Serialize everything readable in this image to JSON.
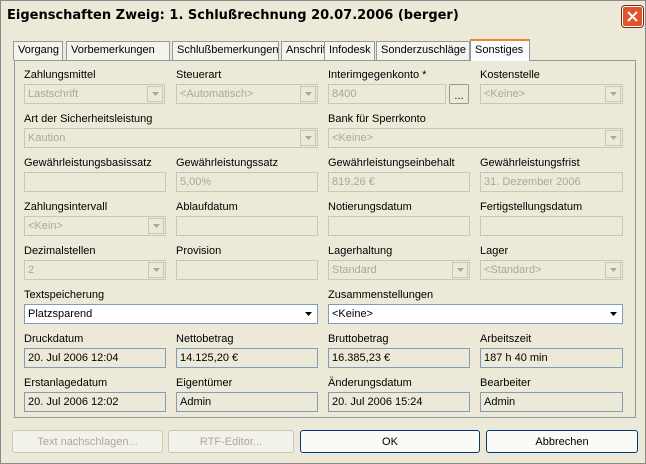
{
  "window": {
    "title": "Eigenschaften Zweig: 1. Schlußrechnung 20.07.2006 (berger)"
  },
  "tabs": [
    {
      "label": "Vorgang"
    },
    {
      "label": "Vorbemerkungen"
    },
    {
      "label": "Schlußbemerkungen"
    },
    {
      "label": "Anschrift"
    },
    {
      "label": "Infodesk"
    },
    {
      "label": "Sonderzuschläge"
    },
    {
      "label": "Sonstiges"
    }
  ],
  "fields": {
    "zahlungsmittel": {
      "label": "Zahlungsmittel",
      "value": "Lastschrift"
    },
    "steuerart": {
      "label": "Steuerart",
      "value": "<Automatisch>"
    },
    "interimgegenkonto": {
      "label": "Interimgegenkonto *",
      "value": "8400",
      "button": "..."
    },
    "kostenstelle": {
      "label": "Kostenstelle",
      "value": "<Keine>"
    },
    "sicherheitsleistung": {
      "label": "Art der Sicherheitsleistung",
      "value": "Kaution"
    },
    "sperrkonto": {
      "label": "Bank für Sperrkonto",
      "value": "<Keine>"
    },
    "basissatz": {
      "label": "Gewährleistungsbasissatz",
      "value": ""
    },
    "satz": {
      "label": "Gewährleistungssatz",
      "value": "5,00%"
    },
    "einbehalt": {
      "label": "Gewährleistungseinbehalt",
      "value": "819,26 €"
    },
    "frist": {
      "label": "Gewährleistungsfrist",
      "value": "31. Dezember 2006"
    },
    "zahlungsintervall": {
      "label": "Zahlungsintervall",
      "value": "<Kein>"
    },
    "ablaufdatum": {
      "label": "Ablaufdatum",
      "value": ""
    },
    "notierungsdatum": {
      "label": "Notierungsdatum",
      "value": ""
    },
    "fertigstellungsdatum": {
      "label": "Fertigstellungsdatum",
      "value": ""
    },
    "dezimalstellen": {
      "label": "Dezimalstellen",
      "value": "2"
    },
    "provision": {
      "label": "Provision",
      "value": ""
    },
    "lagerhaltung": {
      "label": "Lagerhaltung",
      "value": "Standard"
    },
    "lager": {
      "label": "Lager",
      "value": "<Standard>"
    },
    "textspeicherung": {
      "label": "Textspeicherung",
      "value": "Platzsparend"
    },
    "zusammenstellungen": {
      "label": "Zusammenstellungen",
      "value": "<Keine>"
    },
    "druckdatum": {
      "label": "Druckdatum",
      "value": "20. Jul 2006 12:04"
    },
    "nettobetrag": {
      "label": "Nettobetrag",
      "value": "14.125,20 €"
    },
    "bruttobetrag": {
      "label": "Bruttobetrag",
      "value": "16.385,23 €"
    },
    "arbeitszeit": {
      "label": "Arbeitszeit",
      "value": "187 h 40 min"
    },
    "erstanlagedatum": {
      "label": "Erstanlagedatum",
      "value": "20. Jul 2006 12:02"
    },
    "eigentuemer": {
      "label": "Eigentümer",
      "value": "Admin"
    },
    "aenderungsdatum": {
      "label": "Änderungsdatum",
      "value": "20. Jul 2006 15:24"
    },
    "bearbeiter": {
      "label": "Bearbeiter",
      "value": "Admin"
    }
  },
  "buttons": {
    "text_nachschlagen": "Text nachschlagen...",
    "rtf_editor": "RTF-Editor...",
    "ok": "OK",
    "abbrechen": "Abbrechen"
  },
  "icons": {
    "close": "close-icon",
    "dropdown": "chevron-down-icon"
  }
}
